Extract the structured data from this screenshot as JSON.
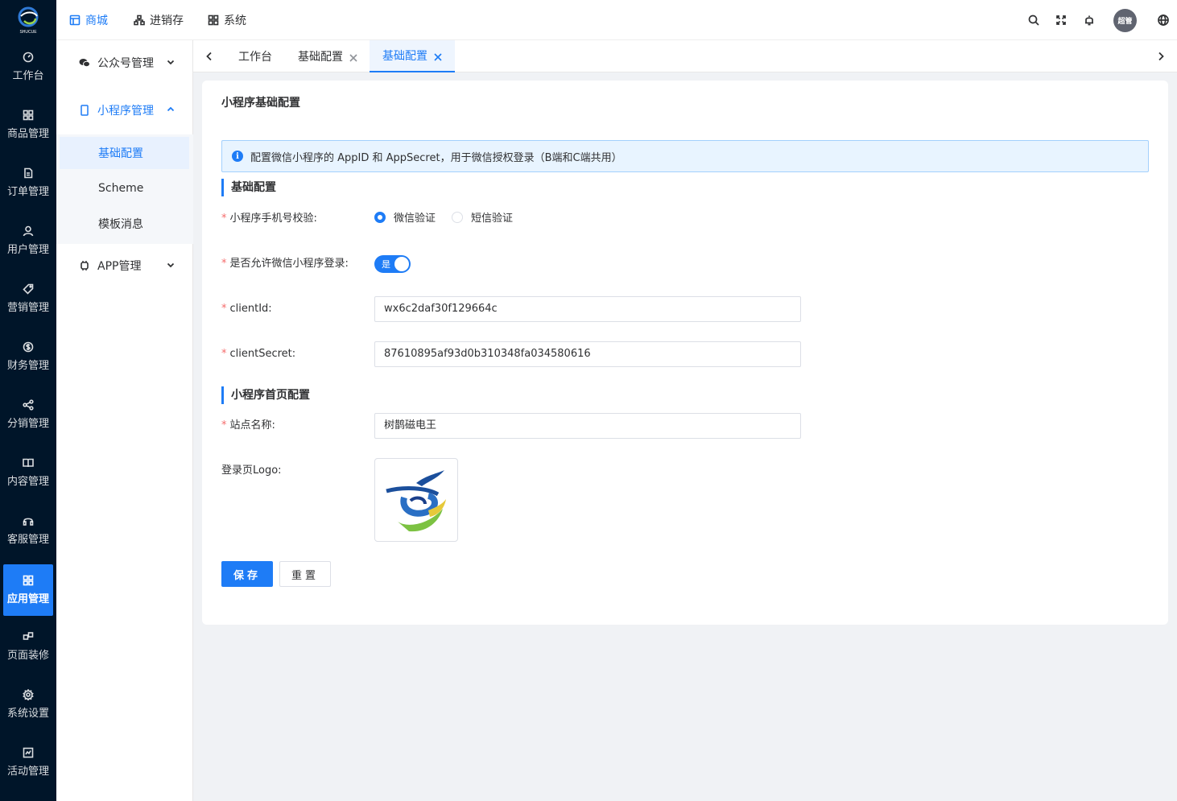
{
  "brand": {
    "logo_text": "SHUCUE"
  },
  "rail": {
    "items": [
      {
        "label": "工作台",
        "icon": "dashboard-icon"
      },
      {
        "label": "商品管理",
        "icon": "grid-icon"
      },
      {
        "label": "订单管理",
        "icon": "document-icon"
      },
      {
        "label": "用户管理",
        "icon": "user-icon"
      },
      {
        "label": "营销管理",
        "icon": "tag-icon"
      },
      {
        "label": "财务管理",
        "icon": "dollar-icon"
      },
      {
        "label": "分销管理",
        "icon": "share-icon"
      },
      {
        "label": "内容管理",
        "icon": "book-icon"
      },
      {
        "label": "客服管理",
        "icon": "headset-icon"
      },
      {
        "label": "应用管理",
        "icon": "apps-icon",
        "active": true
      },
      {
        "label": "页面装修",
        "icon": "layout-icon"
      },
      {
        "label": "系统设置",
        "icon": "gear-icon"
      },
      {
        "label": "活动管理",
        "icon": "activity-icon"
      }
    ]
  },
  "header": {
    "nav": [
      {
        "label": "商城",
        "icon": "store-icon",
        "active": true
      },
      {
        "label": "进销存",
        "icon": "hierarchy-icon"
      },
      {
        "label": "系统",
        "icon": "system-icon"
      }
    ],
    "avatar_text": "超管",
    "icons": [
      "search-icon",
      "fullscreen-icon",
      "bell-icon",
      "globe-icon"
    ]
  },
  "submenu": {
    "groups": [
      {
        "label": "公众号管理",
        "icon": "wechat-icon"
      },
      {
        "label": "小程序管理",
        "icon": "mobile-icon",
        "open": true
      },
      {
        "label": "APP管理",
        "icon": "app-icon"
      }
    ],
    "children": [
      {
        "label": "基础配置",
        "active": true
      },
      {
        "label": "Scheme"
      },
      {
        "label": "模板消息"
      }
    ]
  },
  "tabs": [
    {
      "label": "工作台"
    },
    {
      "label": "基础配置"
    },
    {
      "label": "基础配置",
      "active": true
    }
  ],
  "page": {
    "title": "小程序基础配置",
    "alert": "配置微信小程序的 AppID 和 AppSecret，用于微信授权登录（B端和C端共用）",
    "section_basic": "基础配置",
    "phone_verify_label": "小程序手机号校验:",
    "radio_options": [
      {
        "label": "微信验证",
        "checked": true
      },
      {
        "label": "短信验证",
        "checked": false
      }
    ],
    "allow_login_label": "是否允许微信小程序登录:",
    "switch_text": "是",
    "switch_on": true,
    "client_id_label": "clientId:",
    "client_id_value": "wx6c2daf30f129664c",
    "client_secret_label": "clientSecret:",
    "client_secret_value": "87610895af93d0b310348fa034580616",
    "section_home": "小程序首页配置",
    "site_name_label": "站点名称:",
    "site_name_value": "树鹊磁电王",
    "logo_label": "登录页Logo:",
    "save_label": "保存",
    "reset_label": "重置"
  },
  "colors": {
    "primary": "#1e7cf6",
    "rail_bg": "#001529",
    "required": "#f56c6c"
  }
}
